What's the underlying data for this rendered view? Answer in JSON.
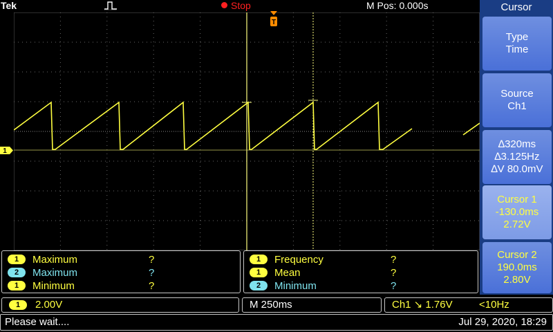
{
  "header": {
    "brand": "Tek",
    "acq_state": "Stop",
    "horizontal_position": "M Pos: 0.000s"
  },
  "channel_marker": {
    "label": "1"
  },
  "side_menu": {
    "title": "Cursor",
    "buttons": [
      {
        "line1": "Type",
        "line2": "Time",
        "line3": ""
      },
      {
        "line1": "Source",
        "line2": "Ch1",
        "line3": ""
      },
      {
        "line1": "∆320ms",
        "line2": "∆3.125Hz",
        "line3": "∆V 80.0mV"
      },
      {
        "line1": "Cursor 1",
        "line2": "-130.0ms",
        "line3": "2.72V"
      },
      {
        "line1": "Cursor 2",
        "line2": "190.0ms",
        "line3": "2.80V"
      }
    ]
  },
  "measurements": {
    "left": [
      {
        "channel": "1",
        "label": "Maximum",
        "value": "?"
      },
      {
        "channel": "2",
        "label": "Maximum",
        "value": "?"
      },
      {
        "channel": "1",
        "label": "Minimum",
        "value": "?"
      }
    ],
    "right": [
      {
        "channel": "1",
        "label": "Frequency",
        "value": "?"
      },
      {
        "channel": "1",
        "label": "Mean",
        "value": "?"
      },
      {
        "channel": "2",
        "label": "Minimum",
        "value": "?"
      }
    ]
  },
  "status": {
    "channel": "1",
    "volts_div": "2.00V",
    "timebase": "M 250ms",
    "trigger": "Ch1 ↘ 1.76V",
    "trigger_freq": "<10Hz",
    "message": "Please wait....",
    "datetime": "Jul 29, 2020, 18:29"
  },
  "colors": {
    "ch1": "#ffff40",
    "ch2": "#7fe3ee",
    "menu_bg": "#1a3d84",
    "stop": "#ff2020",
    "trigger_marker": "#ff8c00"
  }
}
